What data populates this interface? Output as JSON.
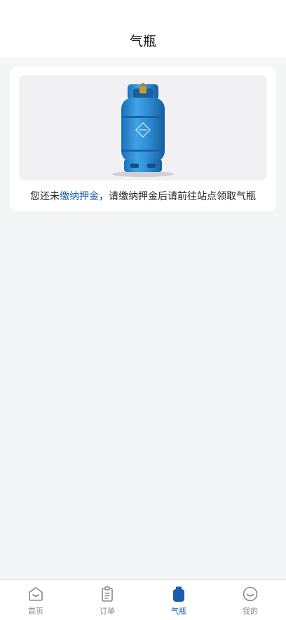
{
  "header": {
    "title": "气瓶"
  },
  "notice": {
    "prefix": "您还未",
    "link": "缴纳押金",
    "suffix": "，请缴纳押金后请前往站点领取气瓶"
  },
  "tabbar": {
    "tabs": [
      {
        "label": "首页",
        "icon": "home-icon",
        "active": false
      },
      {
        "label": "订单",
        "icon": "orders-icon",
        "active": false
      },
      {
        "label": "气瓶",
        "icon": "gas-cylinder-icon",
        "active": true
      },
      {
        "label": "我的",
        "icon": "profile-icon",
        "active": false
      }
    ]
  },
  "colors": {
    "accent": "#1a5cb0",
    "tab_inactive": "#888888",
    "cylinder": "#2f8fd6"
  }
}
